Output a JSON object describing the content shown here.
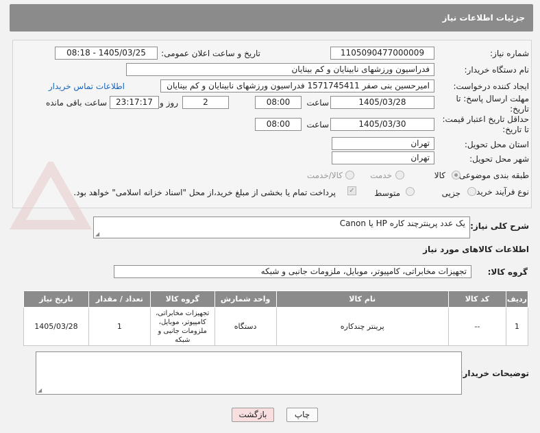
{
  "header": {
    "title": "جزئیات اطلاعات نیاز"
  },
  "form": {
    "need_number_label": "شماره نیاز:",
    "need_number": "1105090477000009",
    "announce_label": "تاریخ و ساعت اعلان عمومی:",
    "announce_value": "1405/03/25 - 08:18",
    "buyer_org_label": "نام دستگاه خریدار:",
    "buyer_org": "فدراسیون ورزشهای نابینایان و کم بینایان",
    "creator_label": "ایجاد کننده درخواست:",
    "creator": "امیرحسین بنی صفر 1571745411 فدراسیون ورزشهای نابینایان و کم بینایان",
    "contact_link": "اطلاعات تماس خریدار",
    "deadline_label_1": "مهلت ارسال پاسخ: تا",
    "deadline_label_2": "تاریخ:",
    "deadline_date": "1405/03/28",
    "hour_label": "ساعت",
    "deadline_time": "08:00",
    "days_value": "2",
    "days_label": "روز و",
    "remaining_time": "23:17:17",
    "remaining_label": "ساعت باقی مانده",
    "validity_label_1": "حداقل تاریخ اعتبار قیمت:",
    "validity_label_2": "تا تاریخ:",
    "validity_date": "1405/03/30",
    "validity_time": "08:00",
    "province_label": "استان محل تحویل:",
    "province": "تهران",
    "city_label": "شهر محل تحویل:",
    "city": "تهران",
    "category_label": "طبقه بندی موضوعی:",
    "category_options": [
      "کالا",
      "خدمت",
      "کالا/خدمت"
    ],
    "process_label": "نوع فرآیند خرید :",
    "process_options": [
      "جزیی",
      "متوسط"
    ],
    "payment_note": "پرداخت تمام یا بخشی از مبلغ خرید،از محل \"اسناد خزانه اسلامی\" خواهد بود."
  },
  "description": {
    "label": "شرح کلی نیاز:",
    "text": "یک عدد پرینترچند کاره HP یا Canon"
  },
  "goods_section": {
    "title": "اطلاعات کالاهای مورد نیاز",
    "group_label": "گروه کالا:",
    "group_value": "تجهیزات مخابراتی، کامپیوتر، موبایل، ملزومات جانبی و شبکه"
  },
  "table": {
    "headers": [
      "ردیف",
      "کد کالا",
      "نام کالا",
      "واحد شمارش",
      "گروه کالا",
      "تعداد / مقدار",
      "تاریخ نیاز"
    ],
    "rows": [
      [
        "1",
        "--",
        "پرینتر چندکاره",
        "دستگاه",
        "تجهیزات مخابراتی، کامپیوتر، موبایل، ملزومات جانبی و شبکه",
        "1",
        "1405/03/28"
      ]
    ]
  },
  "buyer_notes": {
    "label": "توضیحات خریدار:",
    "text": ""
  },
  "buttons": {
    "print": "چاپ",
    "back": "بازگشت"
  },
  "colors": {
    "header_bg": "#8b8b8b",
    "link": "#1565c0",
    "back_bg": "#f8dede"
  }
}
